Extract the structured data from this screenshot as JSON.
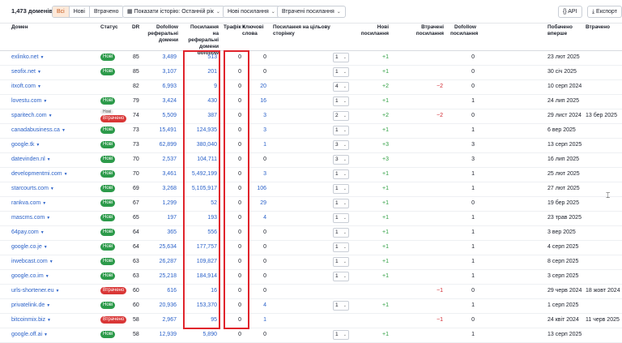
{
  "toolbar": {
    "domains_count": "1,473 доменів",
    "segments": [
      "Всі",
      "Нові",
      "Втрачено"
    ],
    "history_btn": "Показати історію: Останній рік",
    "new_links_btn": "Нові посилання",
    "lost_links_btn": "Втрачені посилання",
    "api_btn": "API",
    "export_btn": "Експорт"
  },
  "columns": {
    "domain": "Домен",
    "status": "Статус",
    "dr": "DR",
    "dofollow_ref": "Dofollow реферальні домени",
    "links_ref": "Посилання на реферальні домени dofollow",
    "traffic": "Трафік",
    "keywords": "Ключові слова",
    "links_target": "Посилання на цільову сторінку",
    "new_links": "Нові посилання",
    "lost_links": "Втрачені посилання",
    "dofollow_links": "Dofollow посилання",
    "first_seen": "Побачено вперше",
    "lost": "Втрачено"
  },
  "rows": [
    {
      "domain": "exlinko.net",
      "status": "Нові",
      "status2": "",
      "dr": "85",
      "ref": "3,489",
      "links": "513",
      "traffic": "0",
      "kw": "0",
      "sel": "1",
      "new": "+1",
      "lost": "",
      "dof": "0",
      "first": "23 лют 2025",
      "lostdate": ""
    },
    {
      "domain": "seofix.net",
      "status": "Нові",
      "status2": "",
      "dr": "85",
      "ref": "3,107",
      "links": "201",
      "traffic": "0",
      "kw": "0",
      "sel": "1",
      "new": "+1",
      "lost": "",
      "dof": "0",
      "first": "30 січ 2025",
      "lostdate": ""
    },
    {
      "domain": "itxoft.com",
      "status": "",
      "status2": "",
      "dr": "82",
      "ref": "6,993",
      "links": "9",
      "traffic": "0",
      "kw": "20",
      "sel": "4",
      "new": "+2",
      "lost": "−2",
      "dof": "0",
      "first": "10 серп 2024",
      "lostdate": ""
    },
    {
      "domain": "lovestu.com",
      "status": "Нові",
      "status2": "",
      "dr": "79",
      "ref": "3,424",
      "links": "430",
      "traffic": "0",
      "kw": "16",
      "sel": "1",
      "new": "+1",
      "lost": "",
      "dof": "1",
      "first": "24 лип 2025",
      "lostdate": ""
    },
    {
      "domain": "sparitech.com",
      "status": "Нові",
      "status2": "Втрачено",
      "dr": "74",
      "ref": "5,509",
      "links": "387",
      "traffic": "0",
      "kw": "3",
      "sel": "2",
      "new": "+2",
      "lost": "−2",
      "dof": "0",
      "first": "29 лист 2024",
      "lostdate": "13 бер 2025"
    },
    {
      "domain": "canadabusiness.ca",
      "status": "Нові",
      "status2": "",
      "dr": "73",
      "ref": "15,491",
      "links": "124,935",
      "traffic": "0",
      "kw": "3",
      "sel": "1",
      "new": "+1",
      "lost": "",
      "dof": "1",
      "first": "6 вер 2025",
      "lostdate": ""
    },
    {
      "domain": "google.tk",
      "status": "Нові",
      "status2": "",
      "dr": "73",
      "ref": "62,899",
      "links": "380,040",
      "traffic": "0",
      "kw": "1",
      "sel": "3",
      "new": "+3",
      "lost": "",
      "dof": "3",
      "first": "13 серп 2025",
      "lostdate": ""
    },
    {
      "domain": "datevinden.nl",
      "status": "Нові",
      "status2": "",
      "dr": "70",
      "ref": "2,537",
      "links": "104,711",
      "traffic": "0",
      "kw": "0",
      "sel": "3",
      "new": "+3",
      "lost": "",
      "dof": "3",
      "first": "16 лип 2025",
      "lostdate": ""
    },
    {
      "domain": "developmentmi.com",
      "status": "Нові",
      "status2": "",
      "dr": "70",
      "ref": "3,461",
      "links": "5,492,199",
      "traffic": "0",
      "kw": "3",
      "sel": "1",
      "new": "+1",
      "lost": "",
      "dof": "1",
      "first": "25 лют 2025",
      "lostdate": ""
    },
    {
      "domain": "starcourts.com",
      "status": "Нові",
      "status2": "",
      "dr": "69",
      "ref": "3,268",
      "links": "5,105,917",
      "traffic": "0",
      "kw": "106",
      "sel": "1",
      "new": "+1",
      "lost": "",
      "dof": "1",
      "first": "27 лют 2025",
      "lostdate": ""
    },
    {
      "domain": "rankva.com",
      "status": "Нові",
      "status2": "",
      "dr": "67",
      "ref": "1,299",
      "links": "52",
      "traffic": "0",
      "kw": "29",
      "sel": "1",
      "new": "+1",
      "lost": "",
      "dof": "0",
      "first": "19 бер 2025",
      "lostdate": ""
    },
    {
      "domain": "mascms.com",
      "status": "Нові",
      "status2": "",
      "dr": "65",
      "ref": "197",
      "links": "193",
      "traffic": "0",
      "kw": "4",
      "sel": "1",
      "new": "+1",
      "lost": "",
      "dof": "1",
      "first": "23 трав 2025",
      "lostdate": ""
    },
    {
      "domain": "64pay.com",
      "status": "Нові",
      "status2": "",
      "dr": "64",
      "ref": "365",
      "links": "556",
      "traffic": "0",
      "kw": "0",
      "sel": "1",
      "new": "+1",
      "lost": "",
      "dof": "1",
      "first": "3 вер 2025",
      "lostdate": ""
    },
    {
      "domain": "google.co.je",
      "status": "Нові",
      "status2": "",
      "dr": "64",
      "ref": "25,634",
      "links": "177,757",
      "traffic": "0",
      "kw": "0",
      "sel": "1",
      "new": "+1",
      "lost": "",
      "dof": "1",
      "first": "4 серп 2025",
      "lostdate": ""
    },
    {
      "domain": "irwebcast.com",
      "status": "Нові",
      "status2": "",
      "dr": "63",
      "ref": "26,287",
      "links": "109,827",
      "traffic": "0",
      "kw": "0",
      "sel": "1",
      "new": "+1",
      "lost": "",
      "dof": "1",
      "first": "8 серп 2025",
      "lostdate": ""
    },
    {
      "domain": "google.co.im",
      "status": "Нові",
      "status2": "",
      "dr": "63",
      "ref": "25,218",
      "links": "184,914",
      "traffic": "0",
      "kw": "0",
      "sel": "1",
      "new": "+1",
      "lost": "",
      "dof": "1",
      "first": "3 серп 2025",
      "lostdate": ""
    },
    {
      "domain": "urls-shortener.eu",
      "status": "Втрачено",
      "status2": "",
      "dr": "60",
      "ref": "616",
      "links": "16",
      "traffic": "0",
      "kw": "0",
      "sel": "",
      "new": "",
      "lost": "−1",
      "dof": "0",
      "first": "29 черв 2024",
      "lostdate": "18 жовт 2024"
    },
    {
      "domain": "privatelink.de",
      "status": "Нові",
      "status2": "",
      "dr": "60",
      "ref": "20,936",
      "links": "153,370",
      "traffic": "0",
      "kw": "4",
      "sel": "1",
      "new": "+1",
      "lost": "",
      "dof": "1",
      "first": "1 серп 2025",
      "lostdate": ""
    },
    {
      "domain": "bitcoinmix.biz",
      "status": "Втрачено",
      "status2": "",
      "dr": "58",
      "ref": "2,967",
      "links": "95",
      "traffic": "0",
      "kw": "1",
      "sel": "",
      "new": "",
      "lost": "−1",
      "dof": "0",
      "first": "24 квіт 2024",
      "lostdate": "11 черв 2025"
    },
    {
      "domain": "google.off.ai",
      "status": "Нові",
      "status2": "",
      "dr": "58",
      "ref": "12,939",
      "links": "5,890",
      "traffic": "0",
      "kw": "0",
      "sel": "1",
      "new": "+1",
      "lost": "",
      "dof": "1",
      "first": "13 серп 2025",
      "lostdate": ""
    }
  ]
}
